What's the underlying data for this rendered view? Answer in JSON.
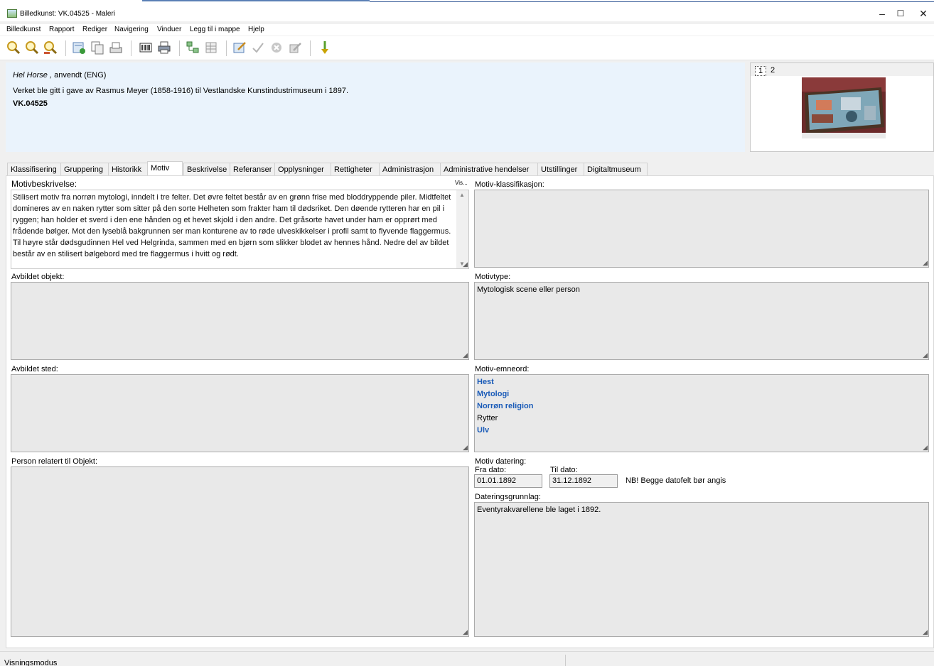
{
  "window": {
    "title": "Billedkunst: VK.04525  - Maleri",
    "minimize": "–",
    "maximize": "☐",
    "close": "✕"
  },
  "menu": [
    "Billedkunst",
    "Rapport",
    "Rediger",
    "Navigering",
    "Vinduer",
    "Legg til i mappe",
    "Hjelp"
  ],
  "header": {
    "title_italic": "Hel Horse ,",
    "title_rest": " anvendt (ENG)",
    "provenance": "Verket ble gitt i gave av Rasmus Meyer (1858-1916) til Vestlandske Kunstindustrimuseum i 1897.",
    "id": "VK.04525"
  },
  "thumbnail_tabs": [
    "1",
    "2"
  ],
  "tabs": [
    "Klassifisering",
    "Gruppering",
    "Historikk",
    "Motiv",
    "Beskrivelse",
    "Referanser",
    "Opplysninger",
    "Rettigheter",
    "Administrasjon",
    "Administrative hendelser",
    "Utstillinger",
    "Digitaltmuseum"
  ],
  "active_tab": "Motiv",
  "fields": {
    "motivbeskrivelse_label": "Motivbeskrivelse:",
    "vis_label": "Vis...",
    "motivbeskrivelse_text": "Stilisert motiv fra norrøn mytologi, inndelt i tre felter. Det øvre feltet består av en grønn frise med bloddryppende piler. Midtfeltet domineres av en naken rytter som sitter på den sorte Helheten som frakter ham til dødsriket. Den døende rytteren har en pil i ryggen; han holder et sverd i den ene hånden og et hevet skjold i den andre. Det gråsorte havet under ham er opprørt med frådende bølger. Mot den lyseblå bakgrunnen ser man konturene av to  røde ulveskikkelser i profil samt to flyvende flaggermus. Til høyre står dødsgudinnen Hel ved Helgrinda, sammen med en bjørn som slikker blodet av hennes hånd. Nedre del av bildet består av en stilisert bølgebord med tre flaggermus i hvitt og rødt.",
    "avbildet_objekt_label": "Avbildet objekt:",
    "avbildet_sted_label": "Avbildet sted:",
    "person_label": "Person relatert til Objekt:",
    "motiv_klassifikasjon_label": "Motiv-klassifikasjon:",
    "motivtype_label": "Motivtype:",
    "motivtype_value": "Mytologisk scene eller person",
    "emneord_label": "Motiv-emneord:",
    "emneord": [
      {
        "text": "Hest",
        "link": true
      },
      {
        "text": "Mytologi",
        "link": true
      },
      {
        "text": "Norrøn religion",
        "link": true
      },
      {
        "text": "Rytter",
        "link": false
      },
      {
        "text": "Ulv",
        "link": true
      }
    ],
    "datering_label": "Motiv datering:",
    "fra_label": "Fra dato:",
    "fra_value": "01.01.1892",
    "til_label": "Til dato:",
    "til_value": "31.12.1892",
    "date_note": "NB! Begge datofelt bør angis",
    "grunnlag_label": "Dateringsgrunnlag:",
    "grunnlag_value": "Eventyrakvarellene ble laget i 1892."
  },
  "status": {
    "mode": "Visningsmodus"
  }
}
